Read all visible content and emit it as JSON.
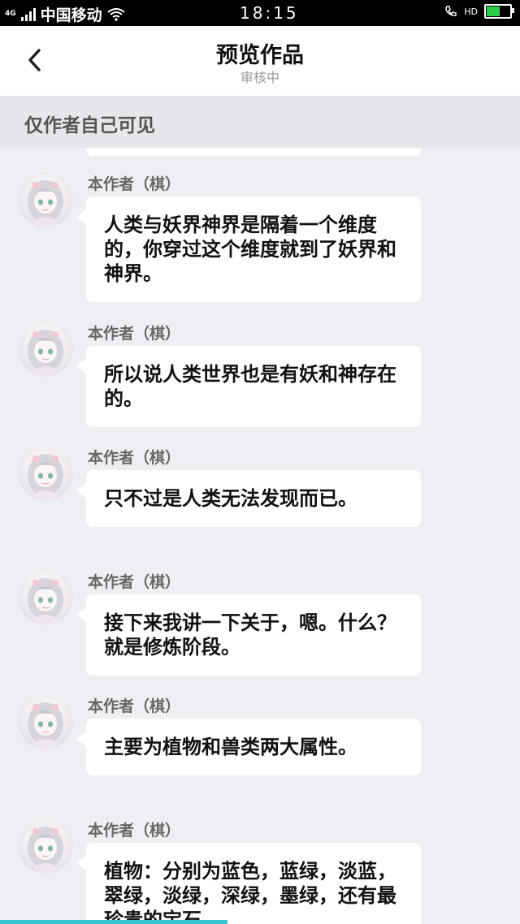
{
  "status_bar": {
    "network": "4G",
    "carrier": "中国移动",
    "time": "18:15",
    "hd_label": "HD",
    "battery_percent": 60,
    "battery_color": "#29d14a"
  },
  "header": {
    "back_icon": "chevron-left-icon",
    "title": "预览作品",
    "subtitle": "审核中"
  },
  "notice": "仅作者自己可见",
  "messages": [
    {
      "author": "本作者（棋）",
      "text": "人类与妖界神界是隔着一个维度的，你穿过这个维度就到了妖界和神界。"
    },
    {
      "author": "本作者（棋）",
      "text": "所以说人类世界也是有妖和神存在的。"
    },
    {
      "author": "本作者（棋）",
      "text": "只不过是人类无法发现而已。"
    },
    {
      "author": "本作者（棋）",
      "text": "接下来我讲一下关于，嗯。什么？就是修炼阶段。"
    },
    {
      "author": "本作者（棋）",
      "text": "主要为植物和兽类两大属性。"
    },
    {
      "author": "本作者（棋）",
      "text": "植物：分别为蓝色，蓝绿，淡蓝，翠绿，淡绿，深绿，墨绿，还有最珍贵的宝石"
    }
  ],
  "accent_color": "#36c5d1"
}
